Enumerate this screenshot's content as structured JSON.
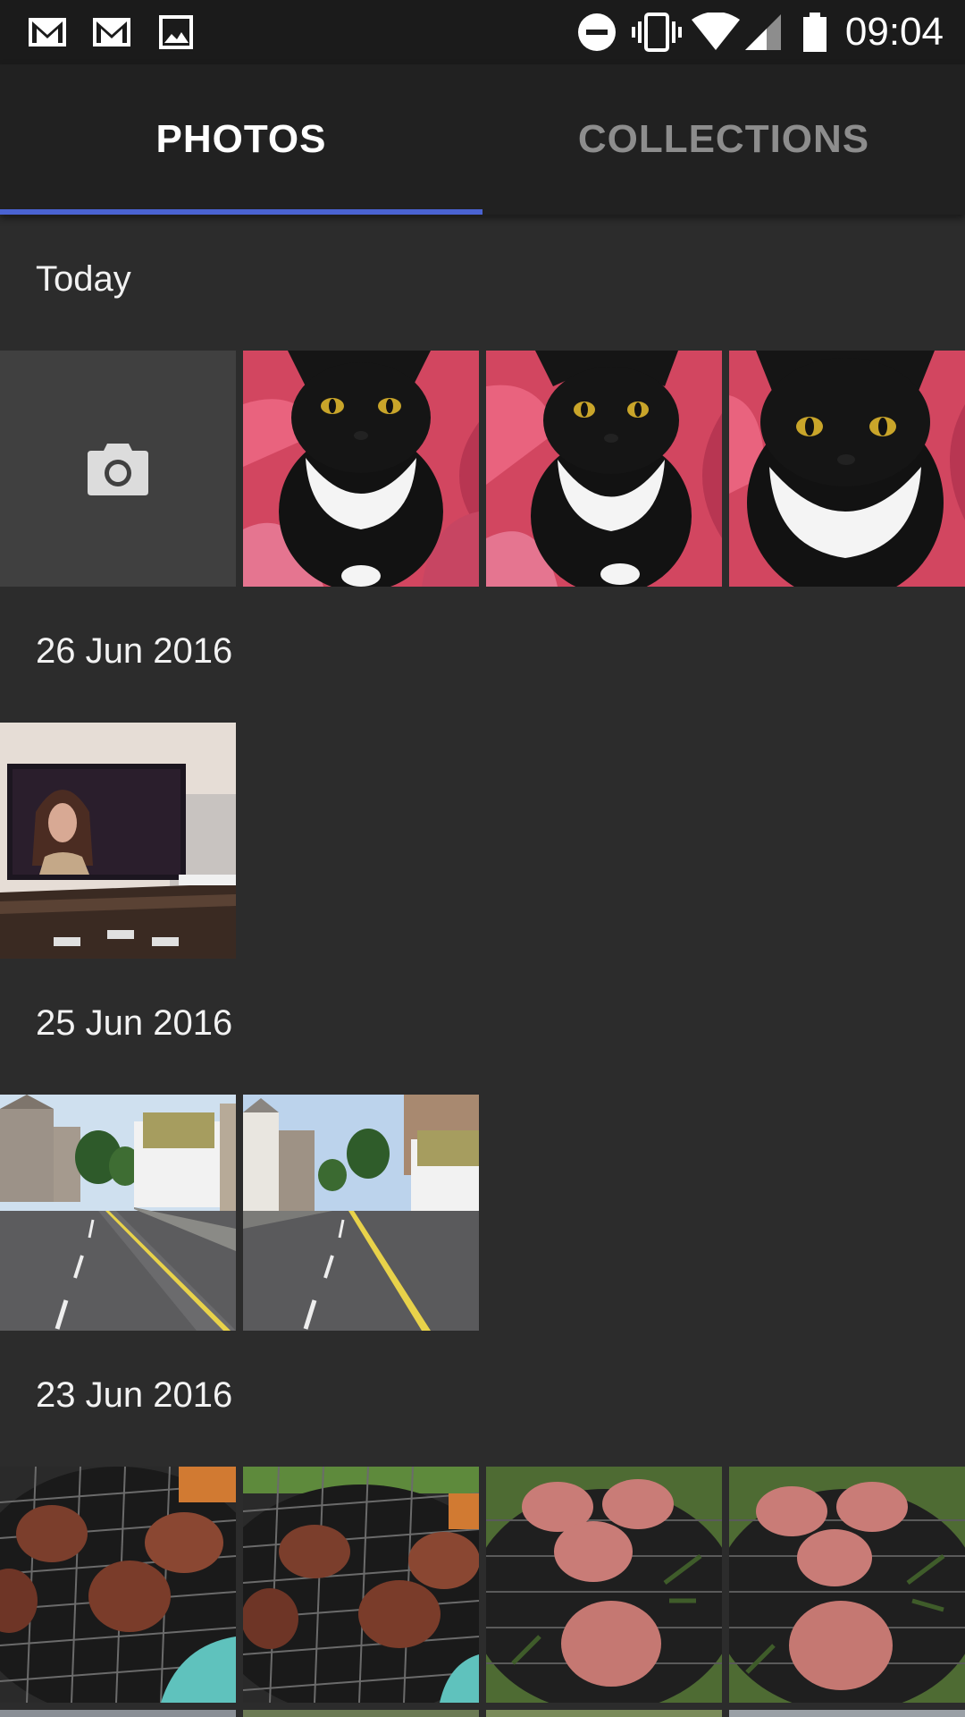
{
  "status_bar": {
    "time": "09:04",
    "left_icons": [
      "gmail-icon",
      "gmail-icon",
      "image-icon"
    ],
    "right_icons": [
      "do-not-disturb-icon",
      "vibrate-icon",
      "wifi-icon",
      "cell-signal-icon",
      "battery-icon"
    ]
  },
  "tabs": [
    {
      "label": "PHOTOS",
      "active": true
    },
    {
      "label": "COLLECTIONS",
      "active": false
    }
  ],
  "sections": [
    {
      "title": "Today",
      "items": [
        "camera-shortcut",
        "cat-photo",
        "cat-photo",
        "cat-photo"
      ]
    },
    {
      "title": "26 Jun 2016",
      "items": [
        "tv-photo"
      ]
    },
    {
      "title": "25 Jun 2016",
      "items": [
        "street-photo",
        "street-photo"
      ]
    },
    {
      "title": "23 Jun 2016",
      "items": [
        "burger-photo",
        "burger-photo",
        "burger-photo",
        "burger-photo"
      ]
    }
  ],
  "colors": {
    "accent": "#4a63d2",
    "background": "#2c2c2c",
    "tabbar": "#212121",
    "statusbar": "#1b1b1b"
  }
}
